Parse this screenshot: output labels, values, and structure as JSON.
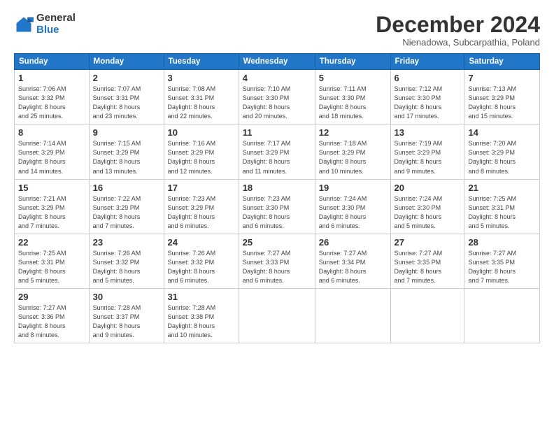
{
  "logo": {
    "general": "General",
    "blue": "Blue"
  },
  "title": "December 2024",
  "subtitle": "Nienadowa, Subcarpathia, Poland",
  "days_header": [
    "Sunday",
    "Monday",
    "Tuesday",
    "Wednesday",
    "Thursday",
    "Friday",
    "Saturday"
  ],
  "weeks": [
    [
      {
        "day": "1",
        "info": "Sunrise: 7:06 AM\nSunset: 3:32 PM\nDaylight: 8 hours\nand 25 minutes."
      },
      {
        "day": "2",
        "info": "Sunrise: 7:07 AM\nSunset: 3:31 PM\nDaylight: 8 hours\nand 23 minutes."
      },
      {
        "day": "3",
        "info": "Sunrise: 7:08 AM\nSunset: 3:31 PM\nDaylight: 8 hours\nand 22 minutes."
      },
      {
        "day": "4",
        "info": "Sunrise: 7:10 AM\nSunset: 3:30 PM\nDaylight: 8 hours\nand 20 minutes."
      },
      {
        "day": "5",
        "info": "Sunrise: 7:11 AM\nSunset: 3:30 PM\nDaylight: 8 hours\nand 18 minutes."
      },
      {
        "day": "6",
        "info": "Sunrise: 7:12 AM\nSunset: 3:30 PM\nDaylight: 8 hours\nand 17 minutes."
      },
      {
        "day": "7",
        "info": "Sunrise: 7:13 AM\nSunset: 3:29 PM\nDaylight: 8 hours\nand 15 minutes."
      }
    ],
    [
      {
        "day": "8",
        "info": "Sunrise: 7:14 AM\nSunset: 3:29 PM\nDaylight: 8 hours\nand 14 minutes."
      },
      {
        "day": "9",
        "info": "Sunrise: 7:15 AM\nSunset: 3:29 PM\nDaylight: 8 hours\nand 13 minutes."
      },
      {
        "day": "10",
        "info": "Sunrise: 7:16 AM\nSunset: 3:29 PM\nDaylight: 8 hours\nand 12 minutes."
      },
      {
        "day": "11",
        "info": "Sunrise: 7:17 AM\nSunset: 3:29 PM\nDaylight: 8 hours\nand 11 minutes."
      },
      {
        "day": "12",
        "info": "Sunrise: 7:18 AM\nSunset: 3:29 PM\nDaylight: 8 hours\nand 10 minutes."
      },
      {
        "day": "13",
        "info": "Sunrise: 7:19 AM\nSunset: 3:29 PM\nDaylight: 8 hours\nand 9 minutes."
      },
      {
        "day": "14",
        "info": "Sunrise: 7:20 AM\nSunset: 3:29 PM\nDaylight: 8 hours\nand 8 minutes."
      }
    ],
    [
      {
        "day": "15",
        "info": "Sunrise: 7:21 AM\nSunset: 3:29 PM\nDaylight: 8 hours\nand 7 minutes."
      },
      {
        "day": "16",
        "info": "Sunrise: 7:22 AM\nSunset: 3:29 PM\nDaylight: 8 hours\nand 7 minutes."
      },
      {
        "day": "17",
        "info": "Sunrise: 7:23 AM\nSunset: 3:29 PM\nDaylight: 8 hours\nand 6 minutes."
      },
      {
        "day": "18",
        "info": "Sunrise: 7:23 AM\nSunset: 3:30 PM\nDaylight: 8 hours\nand 6 minutes."
      },
      {
        "day": "19",
        "info": "Sunrise: 7:24 AM\nSunset: 3:30 PM\nDaylight: 8 hours\nand 6 minutes."
      },
      {
        "day": "20",
        "info": "Sunrise: 7:24 AM\nSunset: 3:30 PM\nDaylight: 8 hours\nand 5 minutes."
      },
      {
        "day": "21",
        "info": "Sunrise: 7:25 AM\nSunset: 3:31 PM\nDaylight: 8 hours\nand 5 minutes."
      }
    ],
    [
      {
        "day": "22",
        "info": "Sunrise: 7:25 AM\nSunset: 3:31 PM\nDaylight: 8 hours\nand 5 minutes."
      },
      {
        "day": "23",
        "info": "Sunrise: 7:26 AM\nSunset: 3:32 PM\nDaylight: 8 hours\nand 5 minutes."
      },
      {
        "day": "24",
        "info": "Sunrise: 7:26 AM\nSunset: 3:32 PM\nDaylight: 8 hours\nand 6 minutes."
      },
      {
        "day": "25",
        "info": "Sunrise: 7:27 AM\nSunset: 3:33 PM\nDaylight: 8 hours\nand 6 minutes."
      },
      {
        "day": "26",
        "info": "Sunrise: 7:27 AM\nSunset: 3:34 PM\nDaylight: 8 hours\nand 6 minutes."
      },
      {
        "day": "27",
        "info": "Sunrise: 7:27 AM\nSunset: 3:35 PM\nDaylight: 8 hours\nand 7 minutes."
      },
      {
        "day": "28",
        "info": "Sunrise: 7:27 AM\nSunset: 3:35 PM\nDaylight: 8 hours\nand 7 minutes."
      }
    ],
    [
      {
        "day": "29",
        "info": "Sunrise: 7:27 AM\nSunset: 3:36 PM\nDaylight: 8 hours\nand 8 minutes."
      },
      {
        "day": "30",
        "info": "Sunrise: 7:28 AM\nSunset: 3:37 PM\nDaylight: 8 hours\nand 9 minutes."
      },
      {
        "day": "31",
        "info": "Sunrise: 7:28 AM\nSunset: 3:38 PM\nDaylight: 8 hours\nand 10 minutes."
      },
      null,
      null,
      null,
      null
    ]
  ]
}
